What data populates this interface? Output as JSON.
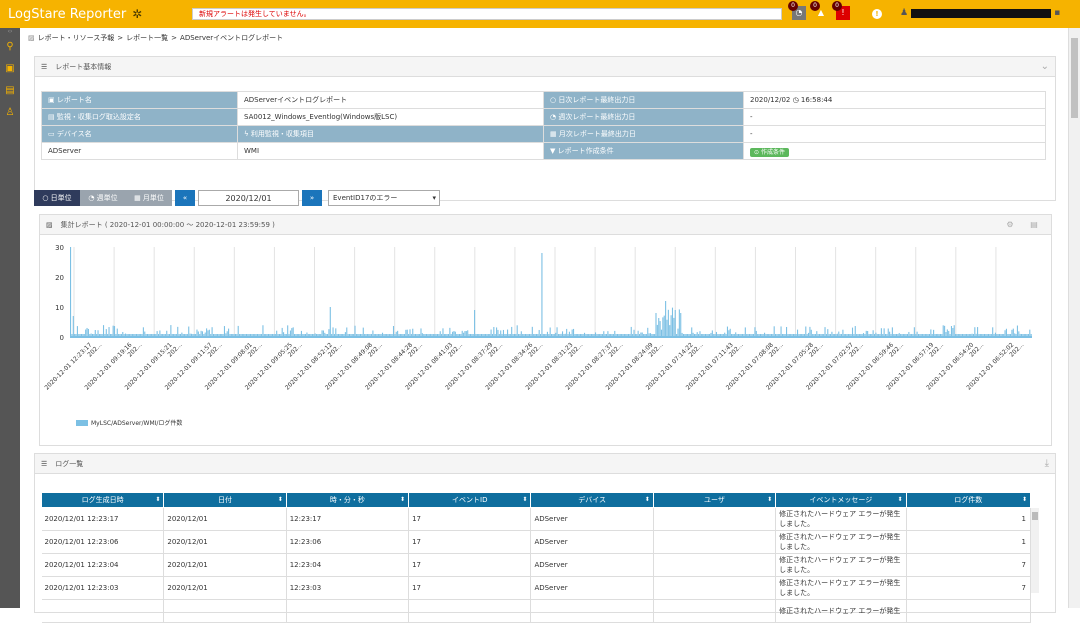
{
  "topbar": {
    "brand": "LogStare Reporter",
    "alert_text": "新規アラートは発生していません。",
    "badges": [
      {
        "name": "info-icon",
        "glyph": "⓵",
        "count": "0"
      },
      {
        "name": "warning-icon",
        "glyph": "⚠",
        "count": "0"
      },
      {
        "name": "error-icon",
        "glyph": "❗",
        "count": "0"
      }
    ],
    "help_glyph": "!",
    "user_icon": "user-icon"
  },
  "sidebar": {
    "items": [
      "search-icon",
      "image-icon",
      "book-icon",
      "users-icon"
    ]
  },
  "breadcrumb": {
    "items": [
      "レポート・リソース予報",
      ">",
      "レポート一覧",
      ">",
      "ADServerイベントログレポート"
    ]
  },
  "basic_info": {
    "title": "レポート基本情報",
    "rows": [
      {
        "l1": "レポート名",
        "v1": "ADServerイベントログレポート",
        "l2": "日次レポート最終出力日",
        "v2": "2020/12/02 ◷ 16:58:44"
      },
      {
        "l1": "監視・収集ログ取込設定名",
        "v1": "SA0012_Windows_Eventlog(Windows版LSC)",
        "l2": "週次レポート最終出力日",
        "v2": "-"
      },
      {
        "l1": "デバイス名",
        "v1": "",
        "l2": "月次レポート最終出力日",
        "v2": "-"
      },
      {
        "l1": "ADServer",
        "v1": "WMI",
        "l2": "レポート作成条件",
        "v2": "作成条件"
      }
    ],
    "sub_label": "利用監視・収集項目"
  },
  "controls": {
    "daily": "日単位",
    "weekly": "週単位",
    "monthly": "月単位",
    "prev": "«",
    "next": "»",
    "date": "2020/12/01",
    "select_value": "EventID17のエラー"
  },
  "chart_panel": {
    "title": "集計レポート ( 2020-12-01 00:00:00 〜 2020-12-01 23:59:59 )",
    "legend": "MyLSC/ADServer/WMI/ログ件数"
  },
  "chart_data": {
    "type": "bar",
    "y_ticks": [
      0,
      10,
      20,
      30
    ],
    "ylim": [
      0,
      30
    ],
    "x_tick_labels": [
      "2020-12-01 12:23:17",
      "2020-12-01 09:19:16",
      "2020-12-01 09:15:21",
      "2020-12-01 09:11:57",
      "2020-12-01 09:08:01",
      "2020-12-01 09:05:25",
      "2020-12-01 08:52:12",
      "2020-12-01 08:49:08",
      "2020-12-01 08:44:28",
      "2020-12-01 08:41:03",
      "2020-12-01 08:37:29",
      "2020-12-01 08:34:26",
      "2020-12-01 08:31:23",
      "2020-12-01 08:27:37",
      "2020-12-01 08:24:09",
      "2020-12-01 07:14:22",
      "2020-12-01 07:11:43",
      "2020-12-01 07:08:08",
      "2020-12-01 07:05:28",
      "2020-12-01 07:02:57",
      "2020-12-01 06:59:46",
      "2020-12-01 06:57:19",
      "2020-12-01 06:54:20",
      "2020-12-01 06:52:02"
    ],
    "sub_tick": "202...",
    "peaks": [
      {
        "pos": 0.0,
        "value": 30
      },
      {
        "pos": 0.003,
        "value": 7
      },
      {
        "pos": 0.27,
        "value": 10
      },
      {
        "pos": 0.42,
        "value": 9
      },
      {
        "pos": 0.49,
        "value": 28
      },
      {
        "pos": 0.62,
        "value": 12
      },
      {
        "pos": 0.61,
        "value": 8
      },
      {
        "pos": 0.63,
        "value": 9
      }
    ],
    "baseline": 1,
    "series": [
      {
        "name": "MyLSC/ADServer/WMI/ログ件数"
      }
    ]
  },
  "log_panel": {
    "title": "ログ一覧",
    "headers": [
      "ログ生成日時",
      "日付",
      "時・分・秒",
      "イベントID",
      "デバイス",
      "ユーザ",
      "イベントメッセージ",
      "ログ件数"
    ],
    "rows": [
      [
        "2020/12/01 12:23:17",
        "2020/12/01",
        "12:23:17",
        "17",
        "ADServer",
        "",
        "修正されたハードウェア エラーが発生しました。",
        "1"
      ],
      [
        "2020/12/01 12:23:06",
        "2020/12/01",
        "12:23:06",
        "17",
        "ADServer",
        "",
        "修正されたハードウェア エラーが発生しました。",
        "1"
      ],
      [
        "2020/12/01 12:23:04",
        "2020/12/01",
        "12:23:04",
        "17",
        "ADServer",
        "",
        "修正されたハードウェア エラーが発生しました。",
        "7"
      ],
      [
        "2020/12/01 12:23:03",
        "2020/12/01",
        "12:23:03",
        "17",
        "ADServer",
        "",
        "修正されたハードウェア エラーが発生しました。",
        "7"
      ],
      [
        "",
        "",
        "",
        "",
        "",
        "",
        "修正されたハードウェア エラーが発生",
        ""
      ]
    ]
  },
  "colors": {
    "accent": "#f6b300",
    "header": "#0f6e9e",
    "label": "#8fb3c8",
    "bar": "#7cc0e4"
  }
}
